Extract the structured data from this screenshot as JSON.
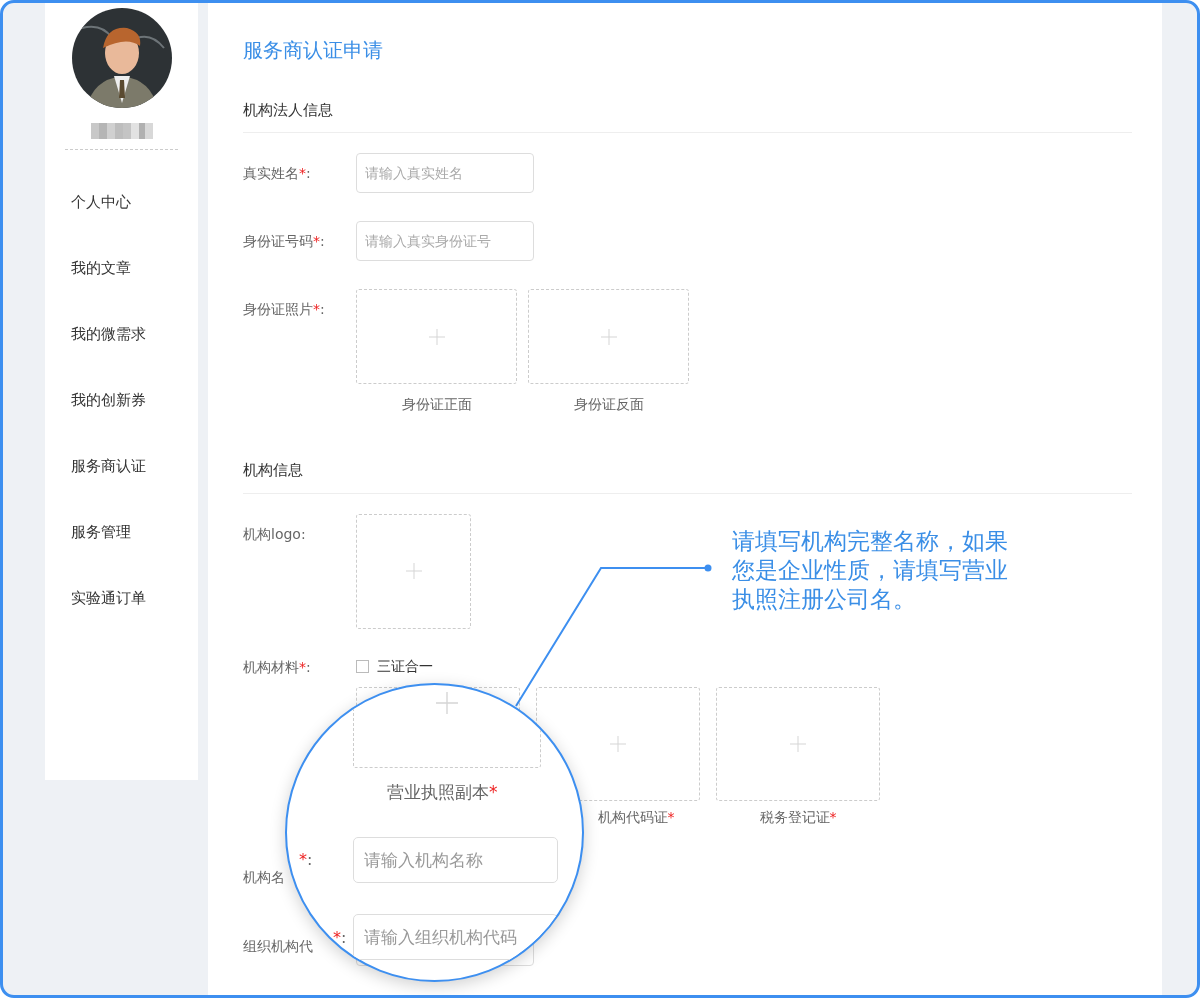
{
  "sidebar": {
    "items": [
      {
        "label": "个人中心",
        "selected": false
      },
      {
        "label": "我的文章",
        "selected": false
      },
      {
        "label": "我的微需求",
        "selected": false
      },
      {
        "label": "我的创新券",
        "selected": false
      },
      {
        "label": "服务商认证",
        "selected": false
      },
      {
        "label": "服务管理",
        "selected": false
      },
      {
        "label": "实验通订单",
        "selected": false
      }
    ]
  },
  "page_title": "服务商认证申请",
  "sections": [
    {
      "title": "机构法人信息",
      "rows": [
        {
          "kind": "input",
          "label": "真实姓名",
          "required_mark": "*",
          "colon": ":",
          "placeholder": "请输入真实姓名"
        },
        {
          "kind": "input",
          "label": "身份证号码",
          "required_mark": "*",
          "colon": ":",
          "placeholder": "请输入真实身份证号"
        },
        {
          "kind": "id_photos",
          "label": "身份证照片",
          "required_mark": "*",
          "colon": ":",
          "uploads": [
            {
              "caption": "身份证正面"
            },
            {
              "caption": "身份证反面"
            }
          ]
        }
      ]
    },
    {
      "title": "机构信息",
      "rows": [
        {
          "kind": "logo",
          "label": "机构logo",
          "colon": ":"
        },
        {
          "kind": "materials",
          "label": "机构材料",
          "required_mark": "*",
          "colon": ":",
          "checkbox": {
            "label": "三证合一",
            "checked": false
          },
          "uploads": [
            {
              "kind": "covered_upload"
            },
            {
              "kind": "upload",
              "caption": "机构代码证",
              "required_mark": "*"
            },
            {
              "kind": "upload",
              "caption": "税务登记证",
              "required_mark": "*"
            }
          ]
        },
        {
          "kind": "label_only",
          "label": "机构名"
        },
        {
          "kind": "blank_input",
          "label": "组织机构代"
        }
      ]
    }
  ],
  "magnifier": {
    "upload": {
      "caption": "营业执照副本",
      "required_mark": "*"
    },
    "fields": [
      {
        "required_mark": "*",
        "colon": ":",
        "placeholder": "请输入机构名称"
      },
      {
        "required_mark": "*",
        "colon": ":",
        "placeholder": "请输入组织机构代码"
      }
    ]
  },
  "callout": {
    "lines": [
      "请填写机构完整名称，如果",
      "您是企业性质，请填写营业",
      "执照注册公司名。"
    ]
  }
}
